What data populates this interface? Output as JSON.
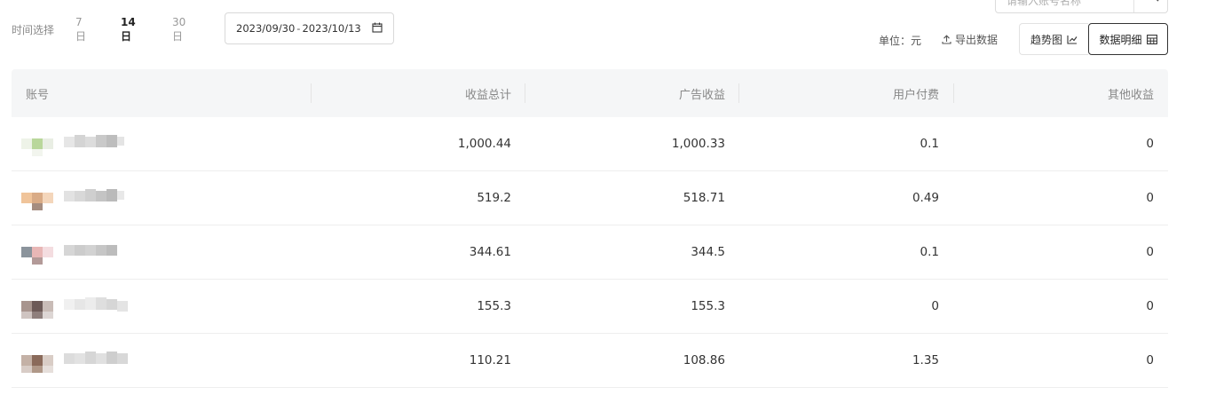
{
  "search": {
    "placeholder": "请输入账号名称"
  },
  "time_filter": {
    "label": "时间选择",
    "options": [
      "7日",
      "14日",
      "30日"
    ],
    "selected": "14日"
  },
  "date_range": {
    "start": "2023/09/30",
    "separator": "-",
    "end": "2023/10/13"
  },
  "toolbar": {
    "unit_label": "单位：元",
    "export_label": "导出数据",
    "trend_label": "趋势图",
    "detail_label": "数据明细",
    "active_view": "数据明细"
  },
  "table": {
    "columns": [
      "账号",
      "收益总计",
      "广告收益",
      "用户付费",
      "其他收益"
    ],
    "rows": [
      {
        "account": "",
        "total": "1,000.44",
        "ad": "1,000.33",
        "user_pay": "0.1",
        "other": "0"
      },
      {
        "account": "",
        "total": "519.2",
        "ad": "518.71",
        "user_pay": "0.49",
        "other": "0"
      },
      {
        "account": "",
        "total": "344.61",
        "ad": "344.5",
        "user_pay": "0.1",
        "other": "0"
      },
      {
        "account": "",
        "total": "155.3",
        "ad": "155.3",
        "user_pay": "0",
        "other": "0"
      },
      {
        "account": "",
        "total": "110.21",
        "ad": "108.86",
        "user_pay": "1.35",
        "other": "0"
      }
    ]
  },
  "colors": {
    "header_bg": "#f5f6f7",
    "active_border": "#333333",
    "muted_text": "#999999"
  }
}
